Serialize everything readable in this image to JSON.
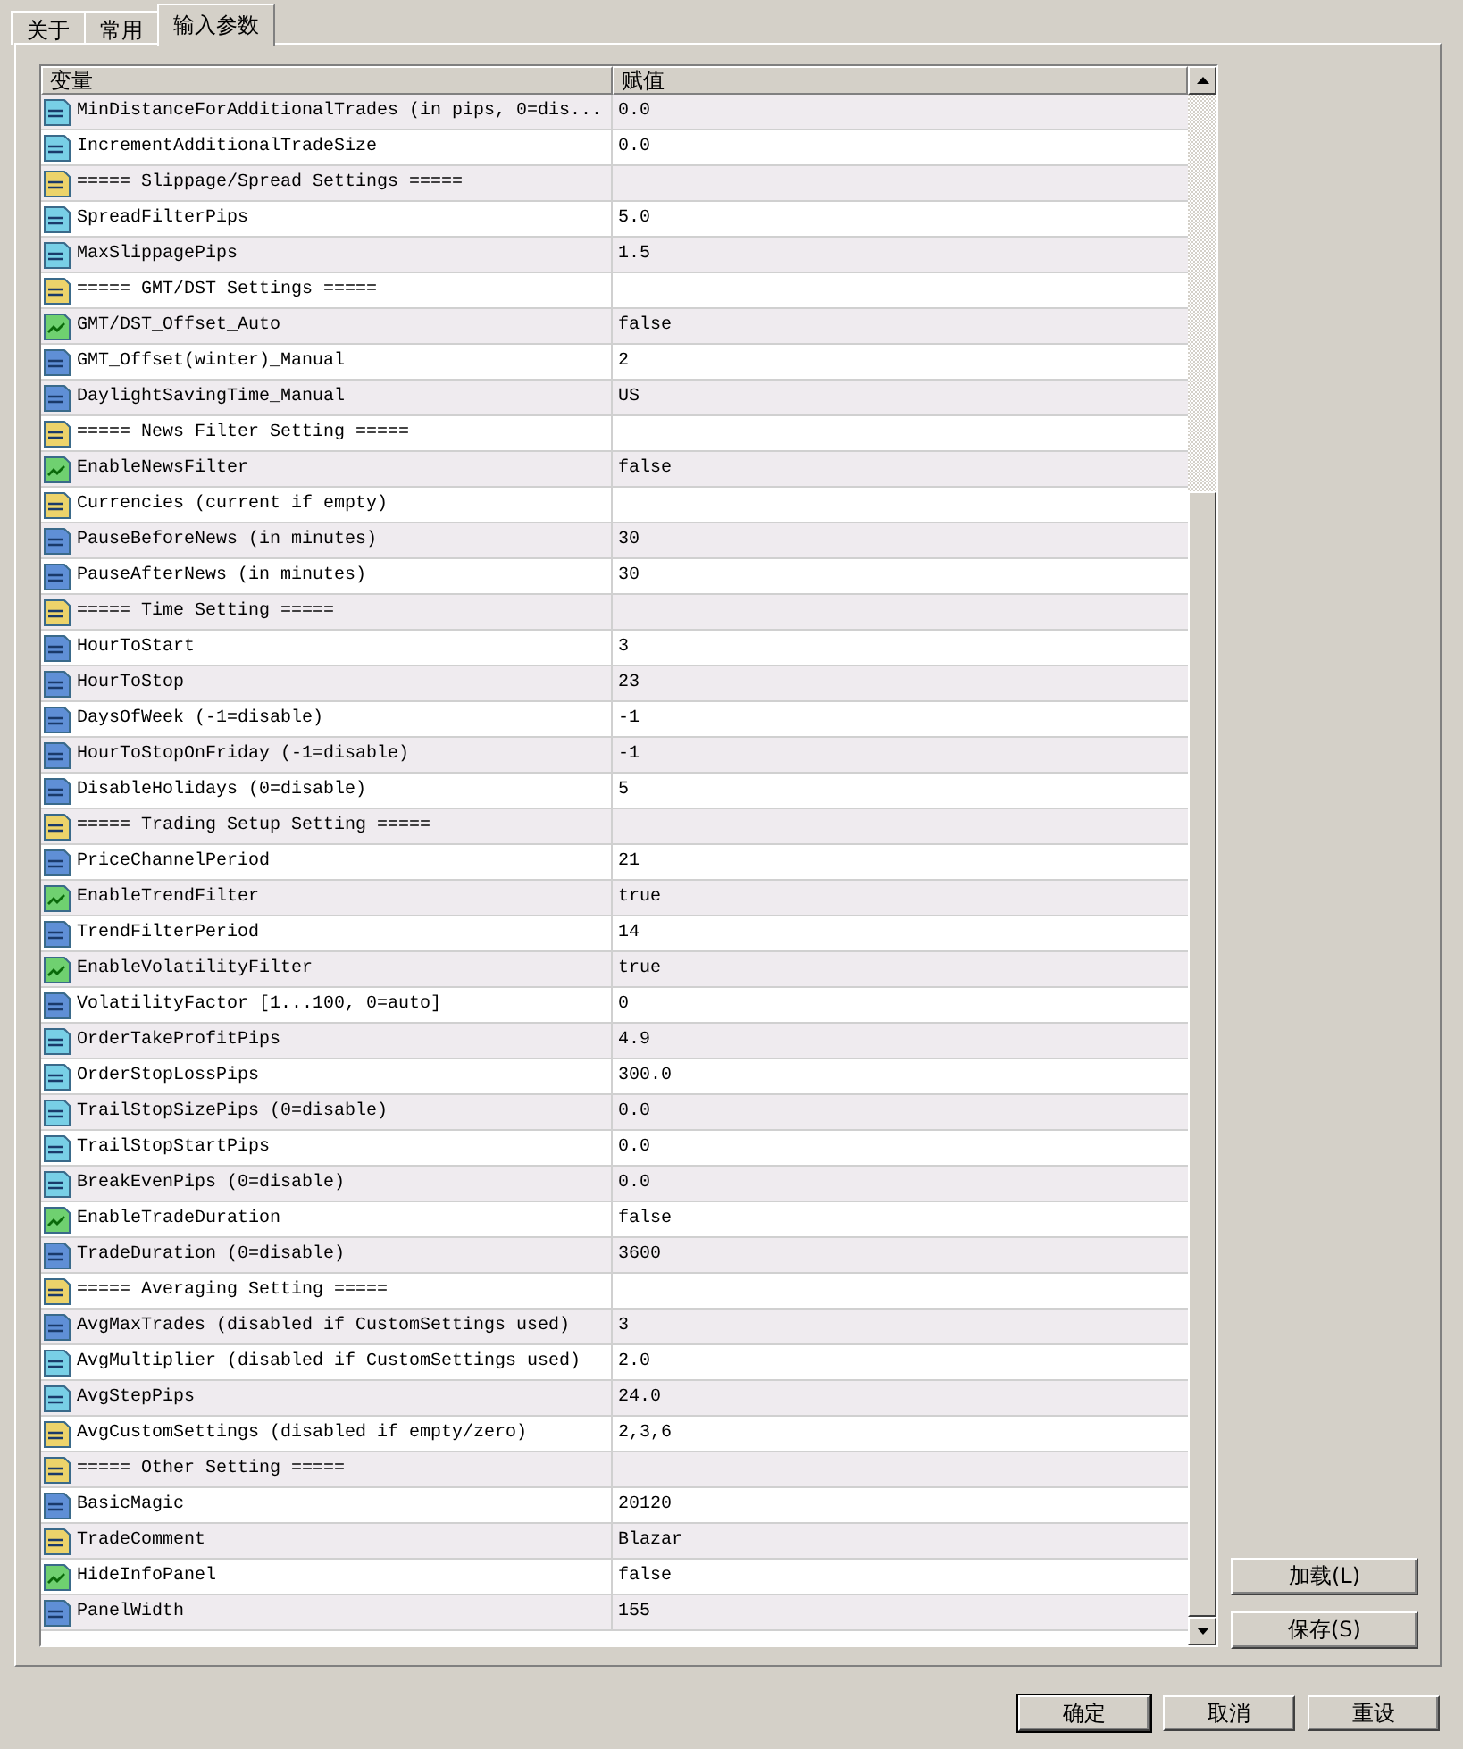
{
  "tabs": [
    {
      "label": "关于",
      "selected": false
    },
    {
      "label": "常用",
      "selected": false
    },
    {
      "label": "输入参数",
      "selected": true
    }
  ],
  "table": {
    "columns": [
      "变量",
      "赋值"
    ],
    "rows": [
      {
        "kind": "double",
        "name": "MinDistanceForAdditionalTrades (in pips, 0=dis...",
        "value": "0.0"
      },
      {
        "kind": "double",
        "name": "IncrementAdditionalTradeSize",
        "value": "0.0"
      },
      {
        "kind": "string",
        "name": "===== Slippage/Spread Settings =====",
        "value": ""
      },
      {
        "kind": "double",
        "name": "SpreadFilterPips",
        "value": "5.0"
      },
      {
        "kind": "double",
        "name": "MaxSlippagePips",
        "value": "1.5"
      },
      {
        "kind": "string",
        "name": "===== GMT/DST Settings =====",
        "value": ""
      },
      {
        "kind": "bool",
        "name": "GMT/DST_Offset_Auto",
        "value": "false"
      },
      {
        "kind": "int",
        "name": "GMT_Offset(winter)_Manual",
        "value": "2"
      },
      {
        "kind": "int",
        "name": "DaylightSavingTime_Manual",
        "value": "US"
      },
      {
        "kind": "string",
        "name": "===== News Filter Setting =====",
        "value": ""
      },
      {
        "kind": "bool",
        "name": "EnableNewsFilter",
        "value": "false"
      },
      {
        "kind": "string",
        "name": "Currencies (current if empty)",
        "value": ""
      },
      {
        "kind": "int",
        "name": "PauseBeforeNews (in minutes)",
        "value": "30"
      },
      {
        "kind": "int",
        "name": "PauseAfterNews (in minutes)",
        "value": "30"
      },
      {
        "kind": "string",
        "name": "===== Time Setting =====",
        "value": ""
      },
      {
        "kind": "int",
        "name": "HourToStart",
        "value": "3"
      },
      {
        "kind": "int",
        "name": "HourToStop",
        "value": "23"
      },
      {
        "kind": "int",
        "name": "DaysOfWeek (-1=disable)",
        "value": "-1"
      },
      {
        "kind": "int",
        "name": "HourToStopOnFriday (-1=disable)",
        "value": "-1"
      },
      {
        "kind": "int",
        "name": "DisableHolidays (0=disable)",
        "value": "5"
      },
      {
        "kind": "string",
        "name": "===== Trading Setup Setting =====",
        "value": ""
      },
      {
        "kind": "int",
        "name": "PriceChannelPeriod",
        "value": "21"
      },
      {
        "kind": "bool",
        "name": "EnableTrendFilter",
        "value": "true"
      },
      {
        "kind": "int",
        "name": "TrendFilterPeriod",
        "value": "14"
      },
      {
        "kind": "bool",
        "name": "EnableVolatilityFilter",
        "value": "true"
      },
      {
        "kind": "int",
        "name": "VolatilityFactor [1...100, 0=auto]",
        "value": "0"
      },
      {
        "kind": "double",
        "name": "OrderTakeProfitPips",
        "value": "4.9"
      },
      {
        "kind": "double",
        "name": "OrderStopLossPips",
        "value": "300.0"
      },
      {
        "kind": "double",
        "name": "TrailStopSizePips (0=disable)",
        "value": "0.0"
      },
      {
        "kind": "double",
        "name": "TrailStopStartPips",
        "value": "0.0"
      },
      {
        "kind": "double",
        "name": "BreakEvenPips (0=disable)",
        "value": "0.0"
      },
      {
        "kind": "bool",
        "name": "EnableTradeDuration",
        "value": "false"
      },
      {
        "kind": "int",
        "name": "TradeDuration (0=disable)",
        "value": "3600"
      },
      {
        "kind": "string",
        "name": "===== Averaging Setting =====",
        "value": ""
      },
      {
        "kind": "int",
        "name": "AvgMaxTrades (disabled if CustomSettings used)",
        "value": "3"
      },
      {
        "kind": "double",
        "name": "AvgMultiplier (disabled if CustomSettings used)",
        "value": "2.0"
      },
      {
        "kind": "double",
        "name": "AvgStepPips",
        "value": "24.0"
      },
      {
        "kind": "string",
        "name": "AvgCustomSettings (disabled if empty/zero)",
        "value": "2,3,6"
      },
      {
        "kind": "string",
        "name": "===== Other Setting =====",
        "value": ""
      },
      {
        "kind": "int",
        "name": "BasicMagic",
        "value": "20120"
      },
      {
        "kind": "string",
        "name": "TradeComment",
        "value": "Blazar"
      },
      {
        "kind": "bool",
        "name": "HideInfoPanel",
        "value": "false"
      },
      {
        "kind": "int",
        "name": "PanelWidth",
        "value": "155"
      }
    ]
  },
  "side_buttons": [
    "加载(L)",
    "保存(S)"
  ],
  "footer_buttons": [
    {
      "label": "确定",
      "selected": true
    },
    {
      "label": "取消",
      "selected": false
    },
    {
      "label": "重设",
      "selected": false
    }
  ]
}
